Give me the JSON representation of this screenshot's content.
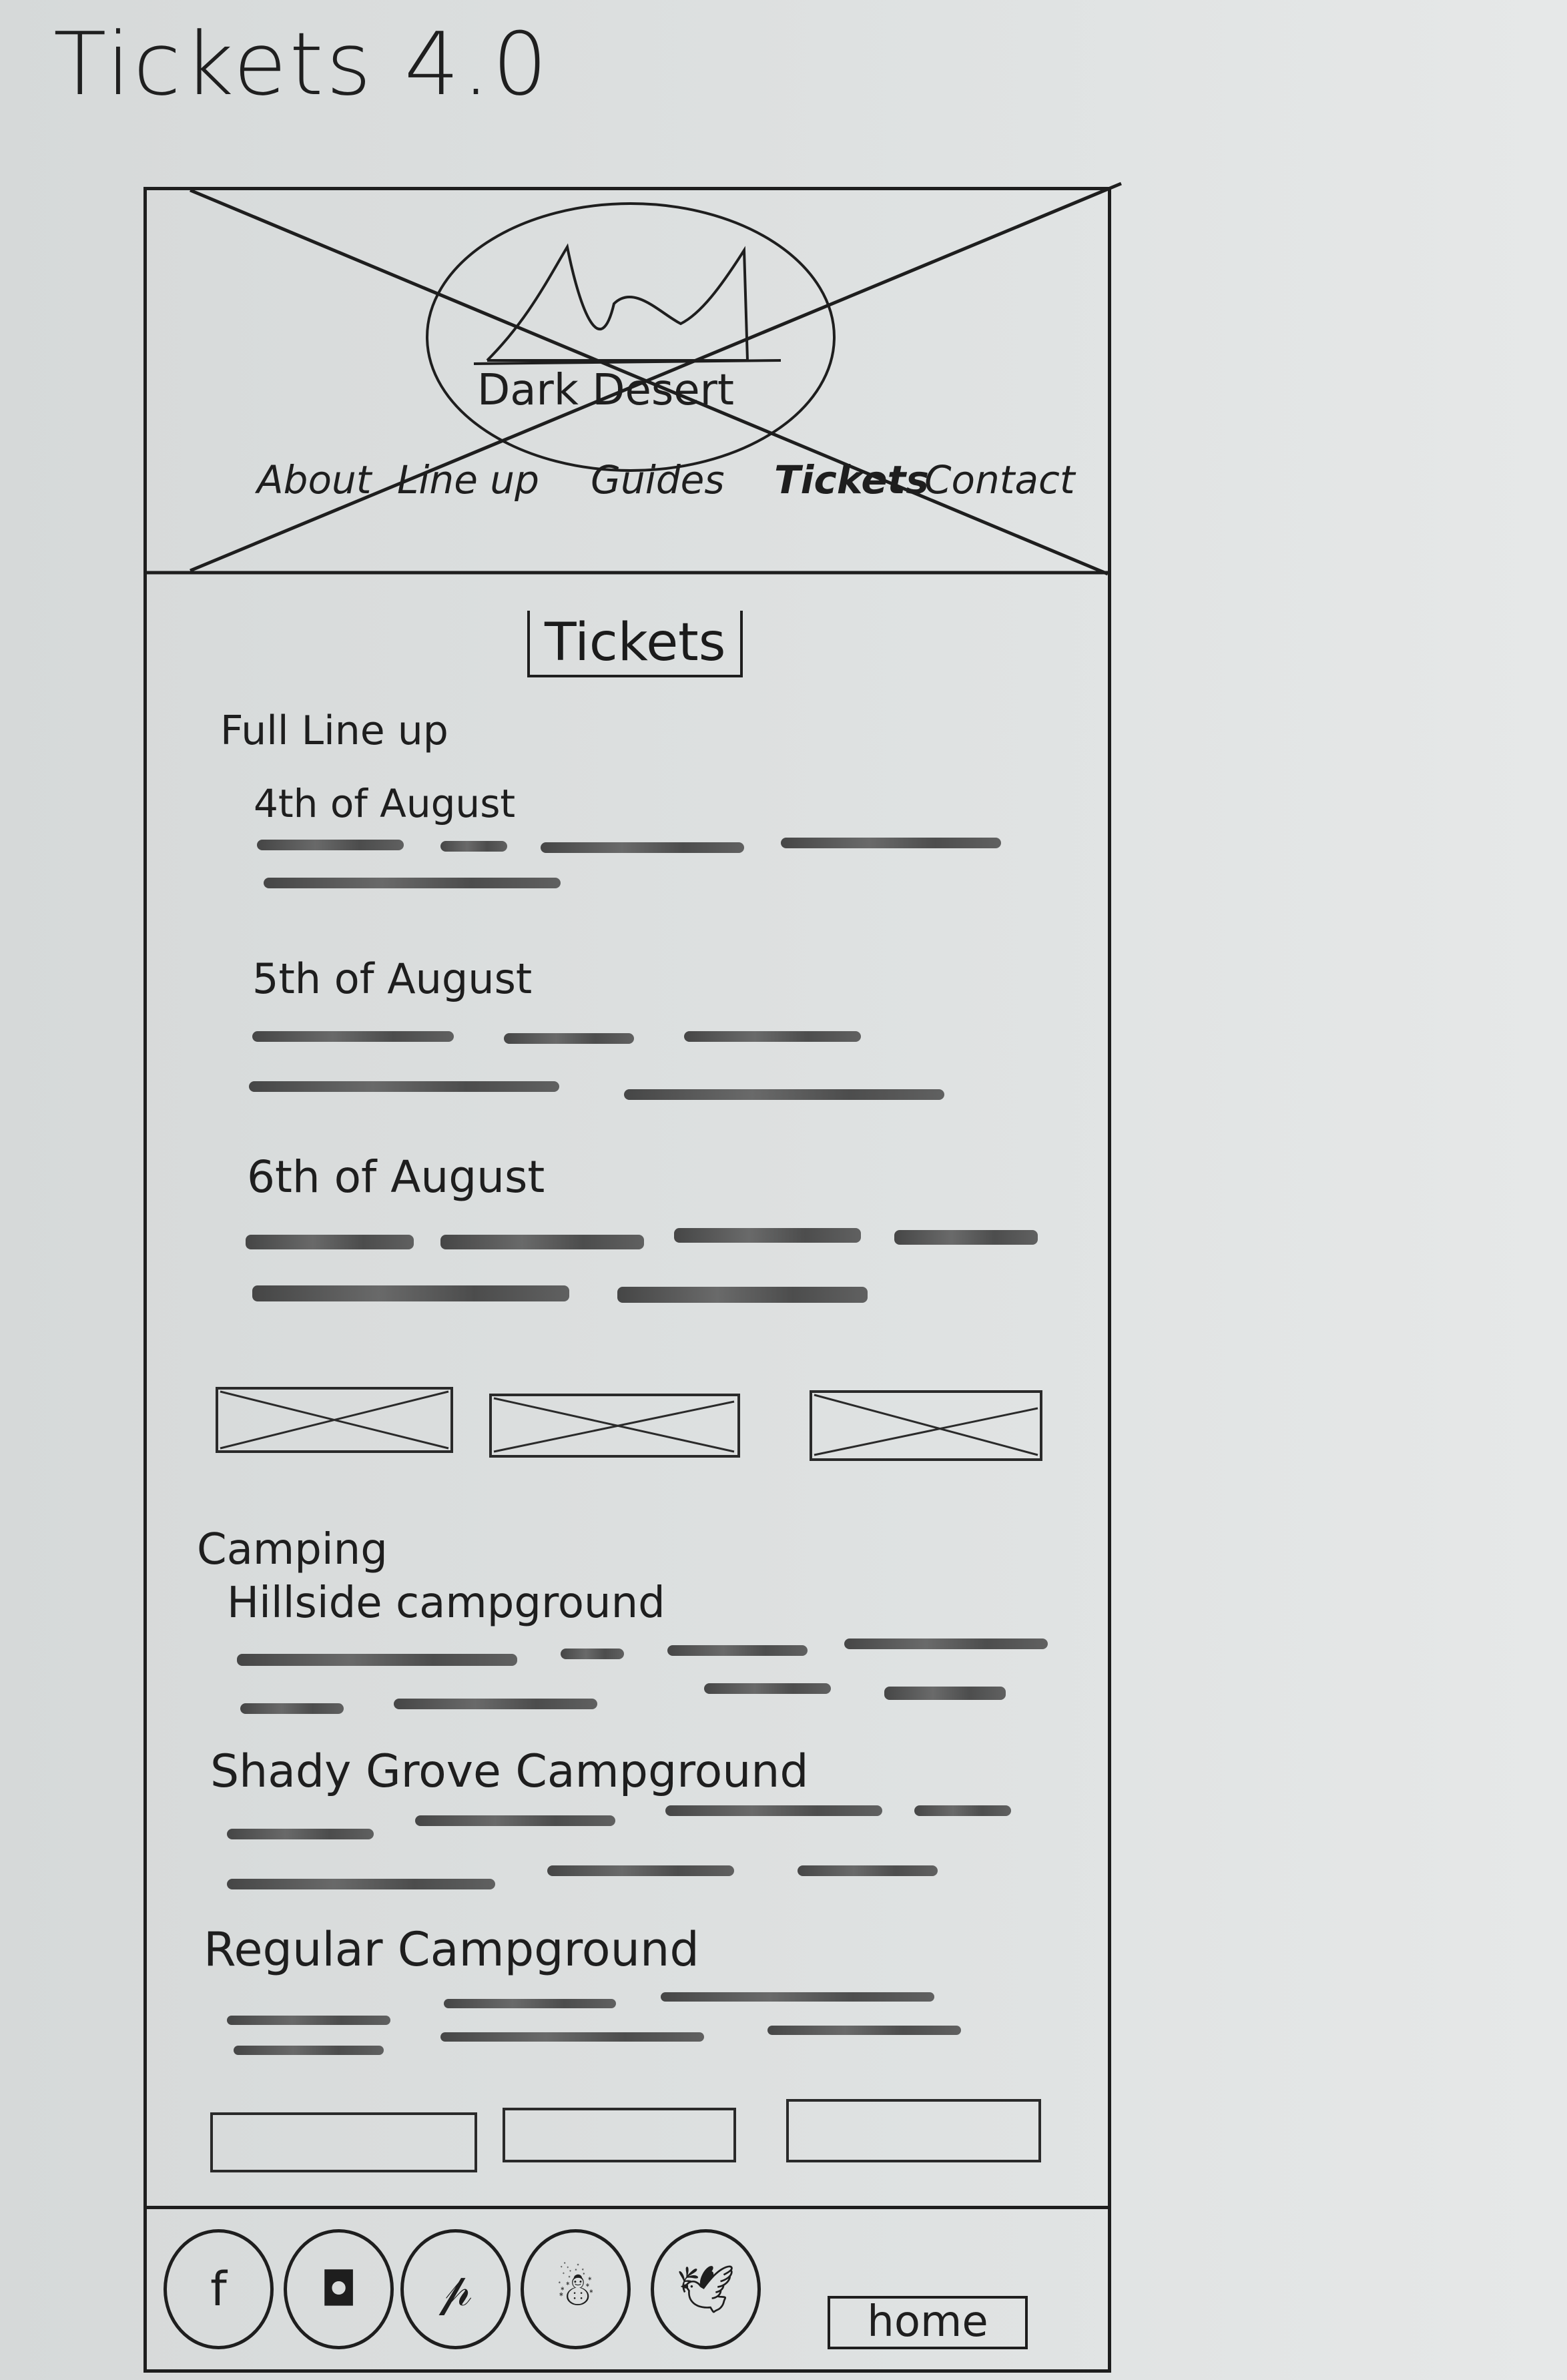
{
  "page": {
    "title": "Tickets 4.0"
  },
  "header": {
    "logo_text": "Dark Desert",
    "nav": [
      {
        "label": "About"
      },
      {
        "label": "Line up"
      },
      {
        "label": "Guides"
      },
      {
        "label": "Tickets"
      },
      {
        "label": "Contact"
      }
    ]
  },
  "main": {
    "section_title": "Tickets",
    "lineup_heading": "Full Line up",
    "days": [
      {
        "label": "4th of August"
      },
      {
        "label": "5th of August"
      },
      {
        "label": "6th of August"
      }
    ],
    "camping_heading": "Camping",
    "campgrounds": [
      {
        "label": "Hillside campground"
      },
      {
        "label": "Shady Grove Campground"
      },
      {
        "label": "Regular Campground"
      }
    ]
  },
  "footer": {
    "social_icons": [
      "facebook-icon",
      "instagram-icon",
      "pinterest-icon",
      "snapchat-icon",
      "twitter-icon"
    ],
    "social_glyphs": [
      "f",
      "◘",
      "𝓅",
      "☃",
      "🕊"
    ],
    "home_label": "home"
  }
}
